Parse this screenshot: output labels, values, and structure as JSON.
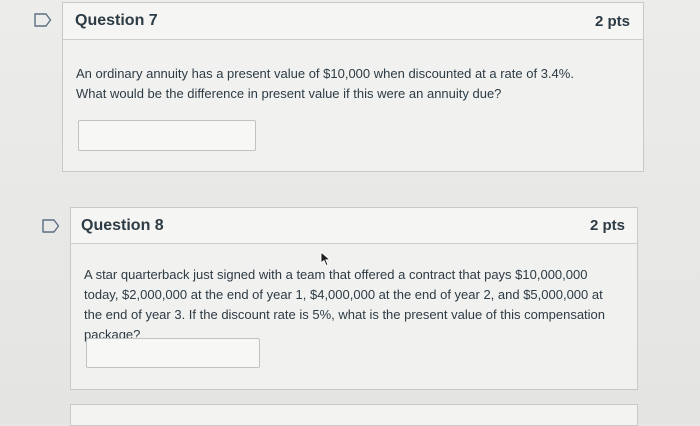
{
  "questions": [
    {
      "title": "Question 7",
      "points": "2 pts",
      "text": "An ordinary annuity has a present value of $10,000 when discounted at a rate of 3.4%. What would be the difference in present value if this were an annuity due?",
      "answer_value": ""
    },
    {
      "title": "Question 8",
      "points": "2 pts",
      "text": "A star quarterback just signed with a team that offered a contract that pays $10,000,000 today, $2,000,000 at the end of year 1, $4,000,000 at the end of year 2, and $5,000,000 at the end of year 3.  If the discount rate is 5%, what is the present value of this compensation package?",
      "answer_value": ""
    }
  ],
  "icons": {
    "flag": "flag-outline-icon",
    "cursor": "mouse-pointer-icon"
  },
  "colors": {
    "text": "#2d3b45",
    "border": "#c9c9c7",
    "flag": "#5b6e82"
  }
}
